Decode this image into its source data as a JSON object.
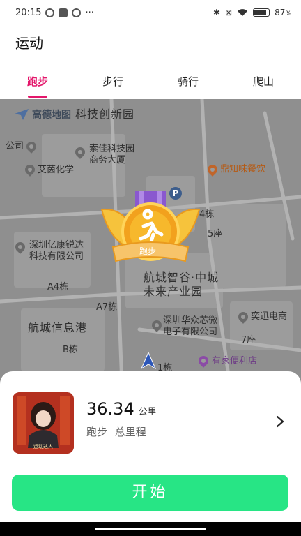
{
  "status_bar": {
    "time": "20:15",
    "more": "···",
    "battery_pct": "87",
    "battery_unit": "%",
    "battery_level": 0.87
  },
  "title": "运动",
  "tabs": [
    {
      "label": "跑步",
      "active": true
    },
    {
      "label": "步行",
      "active": false
    },
    {
      "label": "骑行",
      "active": false
    },
    {
      "label": "爬山",
      "active": false
    }
  ],
  "map": {
    "provider": "高德地图",
    "labels": {
      "park": "科技创新园",
      "company": "公司",
      "suojia": "索佳科技园\n商务大厦",
      "aiyin": "艾茵化学",
      "dingzhiwei": "鼎知味餐饮",
      "yikang": "深圳亿康锐达\n科技有限公司",
      "a4": "A4栋",
      "a7": "A7栋",
      "zhigu": "航城智谷·中城\n未来产业园",
      "b": "B栋",
      "xinxigang": "航城信息港",
      "huazhong": "深圳华众芯微\n电子有限公司",
      "yixun": "奕迅电商",
      "seat7": "7座",
      "seat5": "5座",
      "dong4": "4栋",
      "dong1": "1栋",
      "youjia": "有家便利店"
    },
    "parking": "P",
    "badge_ribbon": "跑步"
  },
  "summary": {
    "distance": "36.34",
    "unit": "公里",
    "sport": "跑步",
    "label": "总里程",
    "avatar_text": "运动达人"
  },
  "start_button": "开始",
  "colors": {
    "accent": "#e4176b",
    "start": "#27e585",
    "map_bg": "#8f8f8f"
  }
}
